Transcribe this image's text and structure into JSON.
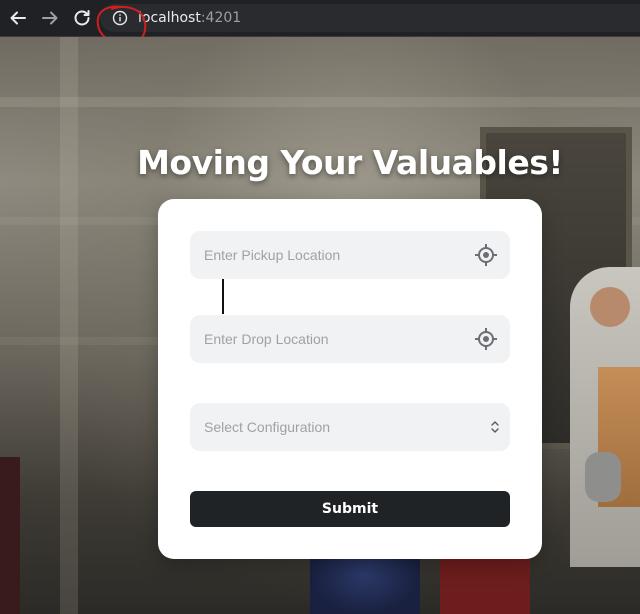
{
  "browser": {
    "url_host": "localhost",
    "url_port": ":4201",
    "icons": [
      "back-arrow-icon",
      "forward-arrow-icon",
      "reload-icon",
      "info-icon"
    ]
  },
  "hero": {
    "title": "Moving Your Valuables!"
  },
  "form": {
    "pickup_placeholder": "Enter Pickup Location",
    "drop_placeholder": "Enter Drop Location",
    "configuration_placeholder": "Select Configuration",
    "submit_label": "Submit"
  },
  "colors": {
    "accent": "#202326",
    "field_bg": "#f1f2f4",
    "annotation": "#d11f1f"
  }
}
